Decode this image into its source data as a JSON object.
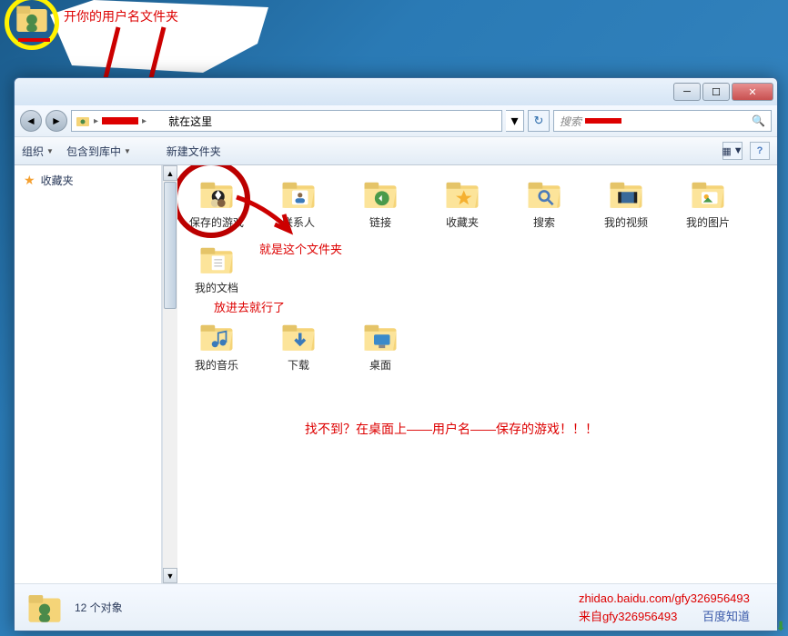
{
  "annotations": {
    "top": "开你的用户名文件夹",
    "folder_callout": "就是这个文件夹",
    "put_in": "放进去就行了",
    "cant_find": "找不到？在桌面上——用户名——保存的游戏！！！"
  },
  "window": {
    "minimize": "─",
    "maximize": "☐",
    "close": "✕"
  },
  "nav": {
    "back": "◄",
    "forward": "►",
    "path_sep": "▸",
    "path_text": "就在这里",
    "dropdown": "▾",
    "refresh": "↻",
    "search_placeholder": "搜索",
    "search_icon": "🔍"
  },
  "toolbar": {
    "organize": "组织",
    "include": "包含到库中",
    "share_hidden": "",
    "new_folder": "新建文件夹",
    "drop": "▼",
    "view_icon": "▦",
    "help_icon": "?"
  },
  "sidebar": {
    "favorites": "收藏夹"
  },
  "folders": [
    {
      "label": "保存的游戏",
      "icon": "games"
    },
    {
      "label": "联系人",
      "icon": "contacts"
    },
    {
      "label": "链接",
      "icon": "links"
    },
    {
      "label": "收藏夹",
      "icon": "favorites"
    },
    {
      "label": "搜索",
      "icon": "search"
    },
    {
      "label": "我的视频",
      "icon": "videos"
    },
    {
      "label": "我的图片",
      "icon": "pictures"
    },
    {
      "label": "我的文档",
      "icon": "documents"
    },
    {
      "label": "我的音乐",
      "icon": "music"
    },
    {
      "label": "下载",
      "icon": "downloads"
    },
    {
      "label": "桌面",
      "icon": "desktop"
    }
  ],
  "status": {
    "count": "12 个对象"
  },
  "footer": {
    "url": "zhidao.baidu.com/gfy326956493",
    "from": "来自gfy326956493",
    "site": "百度知道"
  }
}
